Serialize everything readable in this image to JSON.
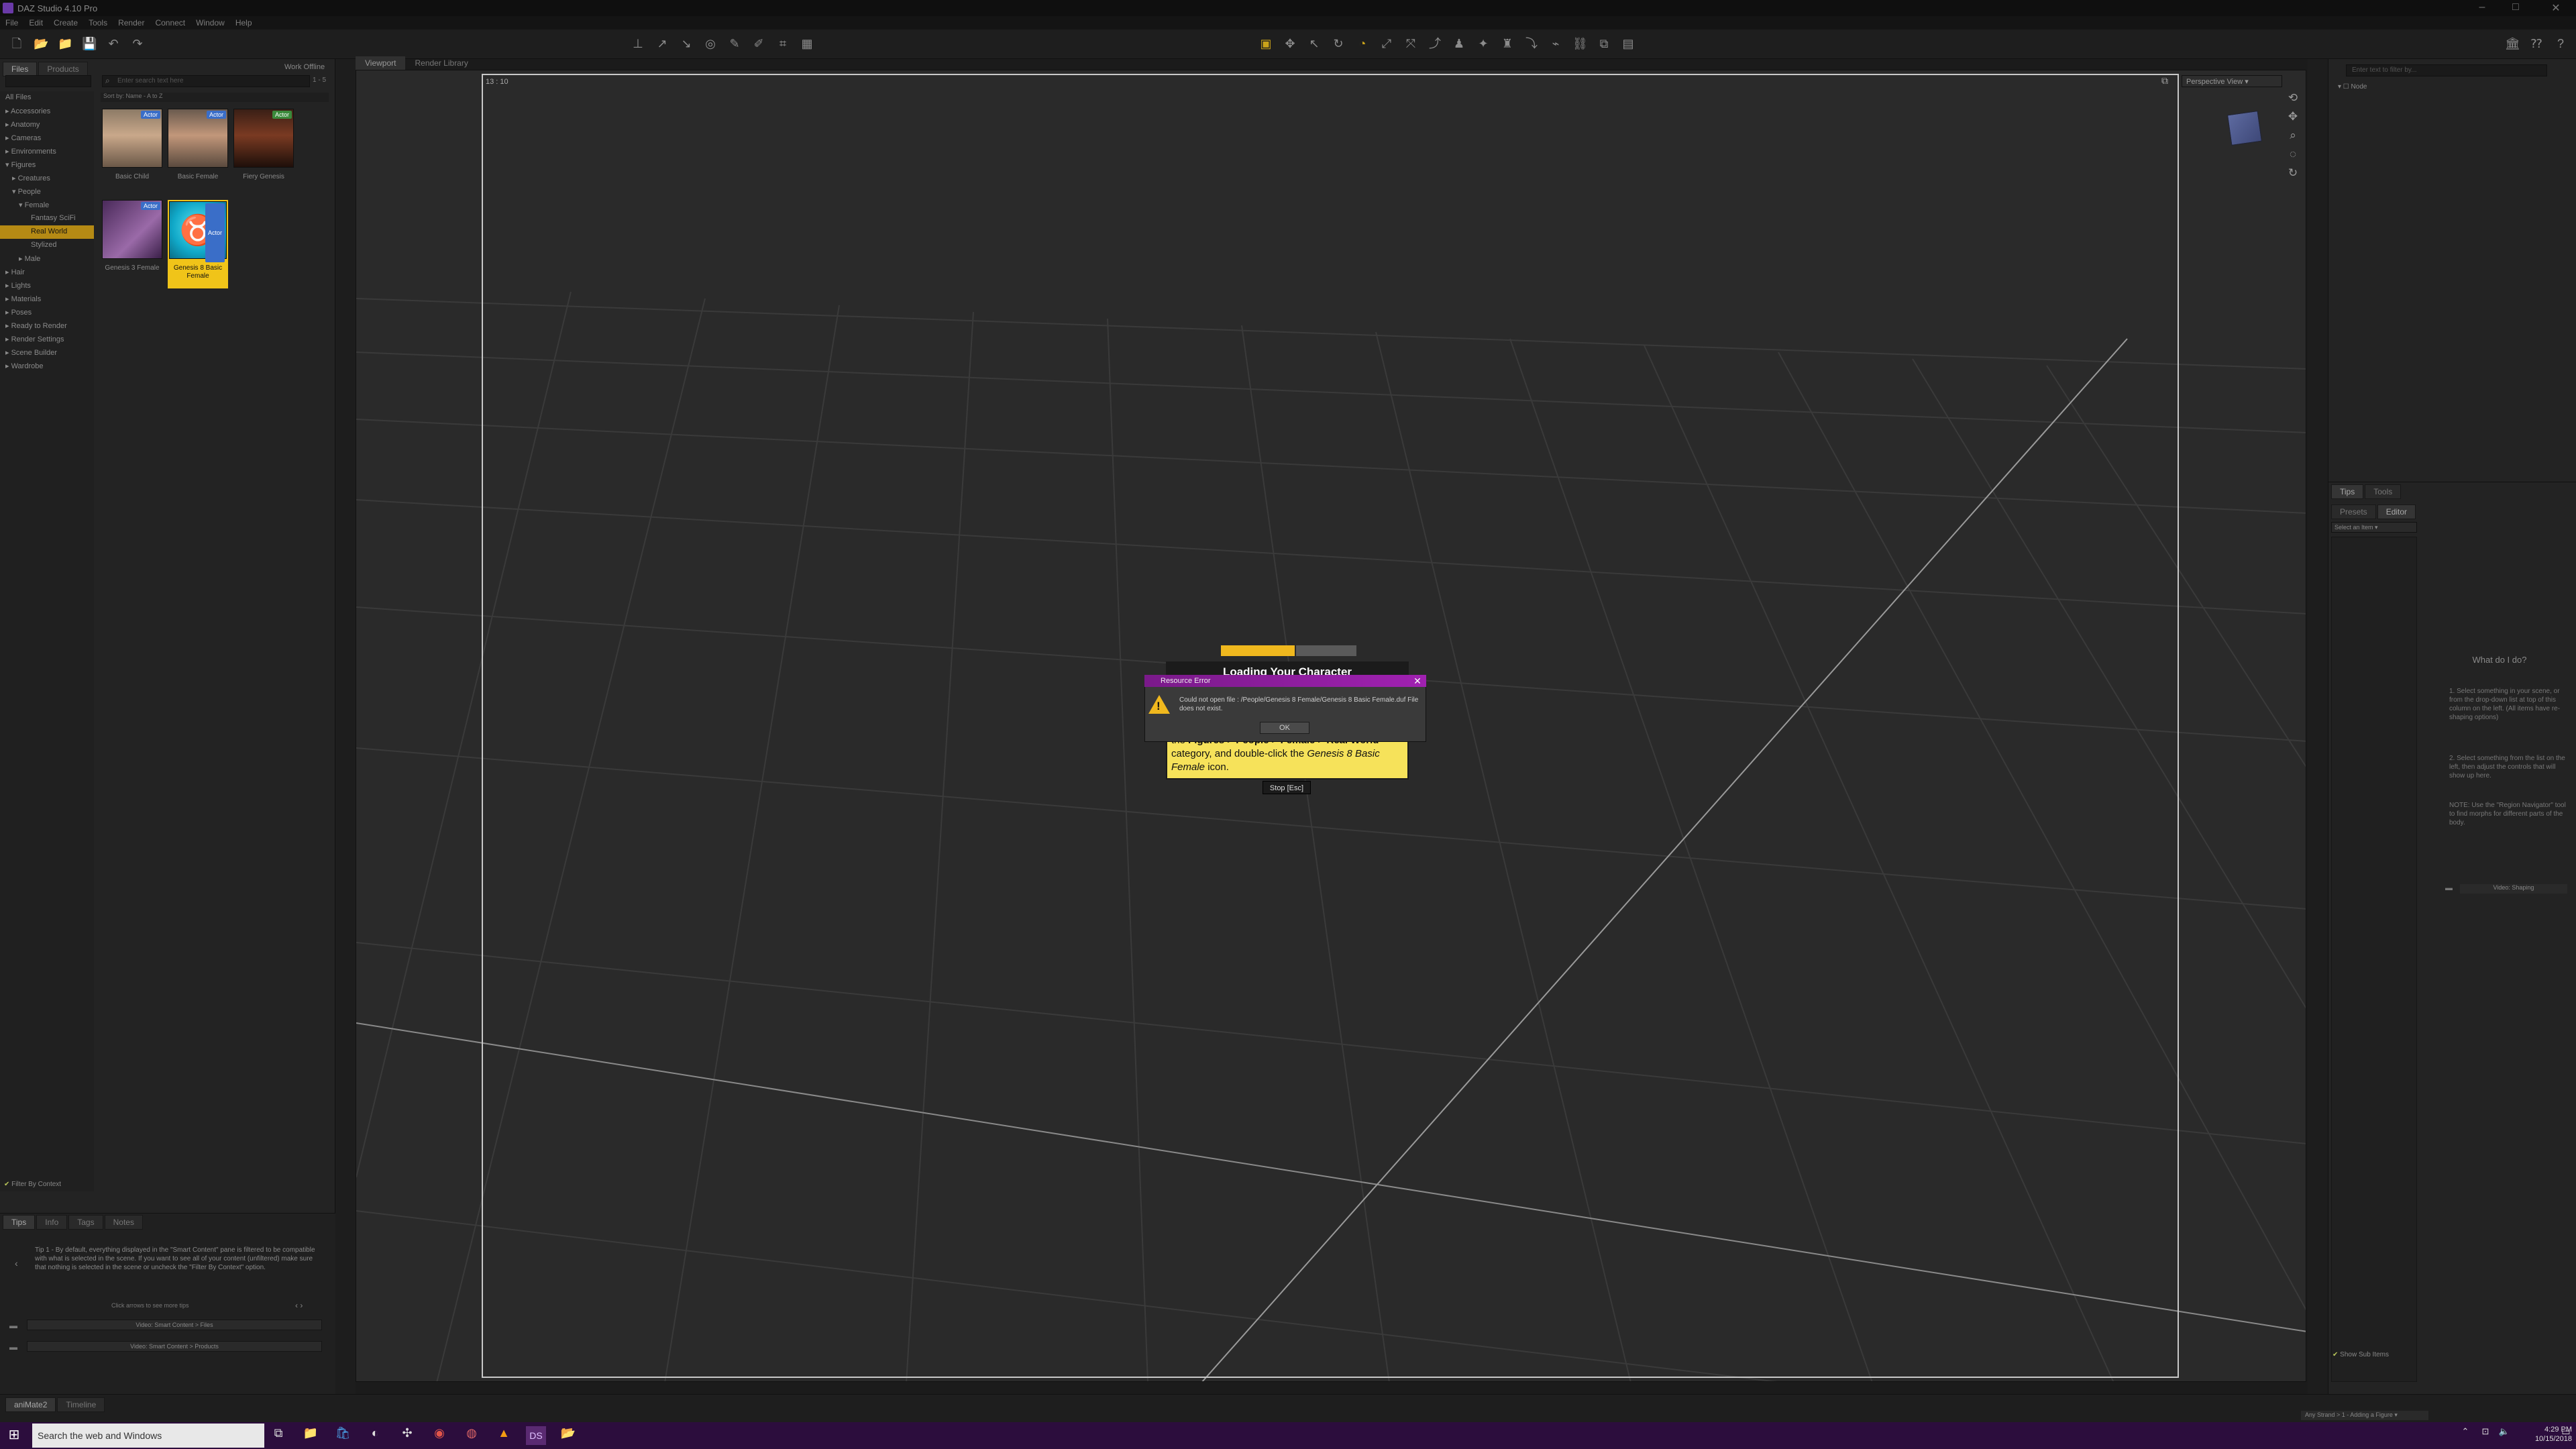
{
  "window": {
    "title": "DAZ Studio 4.10 Pro",
    "menu": [
      "File",
      "Edit",
      "Create",
      "Tools",
      "Render",
      "Connect",
      "Window",
      "Help"
    ]
  },
  "left_panel": {
    "tabs": [
      "Files",
      "Products"
    ],
    "header_right": "Work Offline",
    "search_placeholder": "Enter search text here",
    "sort_label": "Sort by: Name - A to Z",
    "page_count": "1 - 5",
    "categories": [
      "All Files",
      "Accessories",
      "Anatomy",
      "Cameras",
      "Environments",
      "Figures",
      "Creatures",
      "People",
      "Female",
      "Fantasy SciFi",
      "Real World",
      "Stylized",
      "Male",
      "Hair",
      "Lights",
      "Materials",
      "Poses",
      "Ready to Render",
      "Render Settings",
      "Scene Builder",
      "Wardrobe"
    ],
    "selected_category": "Real World",
    "thumbnails": [
      {
        "name": "Basic Child",
        "badge": "Actor"
      },
      {
        "name": "Basic Female",
        "badge": "Actor"
      },
      {
        "name": "Fiery Genesis",
        "badge": "Actor"
      },
      {
        "name": "Genesis 3 Female",
        "badge": "Actor"
      },
      {
        "name": "Genesis 8 Basic Female",
        "badge": "Actor"
      }
    ],
    "filter_checkbox": "Filter By Context",
    "tips_tabs": [
      "Tips",
      "Info",
      "Tags",
      "Notes"
    ],
    "tip_text": "Tip 1 - By default, everything displayed in the \"Smart Content\" pane is filtered to be compatible with what is selected in the scene. If you want to see all of your content (unfiltered) make sure that nothing is selected in the scene or uncheck the \"Filter By Context\" option.",
    "tips_nav": "Click arrows to see more tips",
    "video_links": [
      "Video: Smart Content > Files",
      "Video: Smart Content > Products"
    ]
  },
  "viewport": {
    "tabs": [
      "Viewport",
      "Render Library"
    ],
    "corner_label": "13 : 10",
    "view_select": "Perspective View"
  },
  "loading": {
    "title": "Loading Your Character",
    "text_prefix": "the ",
    "text_bold": "Figures > People > Female > Real World",
    "text_mid": " category, and double-click the ",
    "text_italic": "Genesis 8 Basic Female",
    "text_suffix": " icon.",
    "stop_button": "Stop [Esc]"
  },
  "error_dialog": {
    "title": "Resource Error",
    "message": "Could not open file : /People/Genesis 8 Female/Genesis 8 Basic Female.duf File does not exist.",
    "ok_button": "OK"
  },
  "right_panel": {
    "search_placeholder": "Enter text to filter by...",
    "tree_item": "Node",
    "tabs_top": [
      "Tips",
      "Tools"
    ],
    "tabs_lower": [
      "Presets",
      "Editor"
    ],
    "select_label": "Select an Item",
    "help_title": "What do I do?",
    "help_steps": [
      "1. Select something in your scene, or from the drop-down list at top of this column on the left. (All items have re-shaping options)",
      "2. Select something from the list on the left, then adjust the controls that will show up here."
    ],
    "note": "NOTE: Use the \"Region Navigator\" tool to find morphs for different parts of the body.",
    "video_link": "Video: Shaping",
    "show_sub_items": "Show Sub Items"
  },
  "status_bar": {
    "tabs": [
      "aniMate2",
      "Timeline"
    ],
    "lesson_select": "Any Strand > 1 - Adding a Figure"
  },
  "taskbar": {
    "search_placeholder": "Search the web and Windows",
    "time": "4:29 PM",
    "date": "10/15/2018"
  },
  "colors": {
    "accent_yellow": "#f0c419",
    "dialog_purple": "#a021b1",
    "taskbar": "#2c0d3d"
  }
}
